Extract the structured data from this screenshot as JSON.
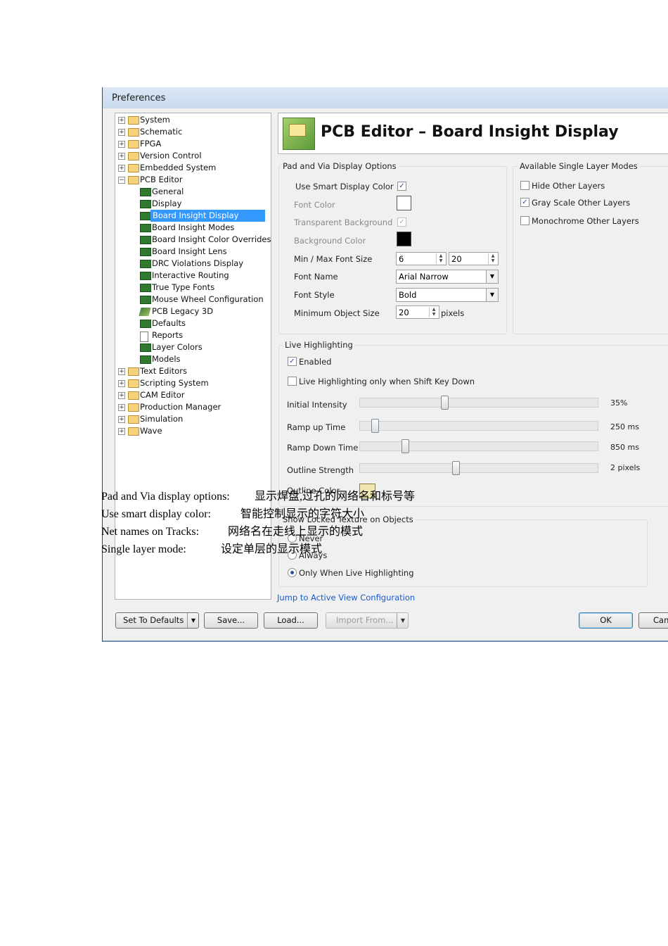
{
  "window": {
    "title": "Preferences"
  },
  "tree": {
    "items": [
      {
        "label": "System",
        "level": 0,
        "expander": "+",
        "icon": "folder-icon"
      },
      {
        "label": "Schematic",
        "level": 0,
        "expander": "+",
        "icon": "folder-icon"
      },
      {
        "label": "FPGA",
        "level": 0,
        "expander": "+",
        "icon": "folder-icon"
      },
      {
        "label": "Version Control",
        "level": 0,
        "expander": "+",
        "icon": "folder-icon"
      },
      {
        "label": "Embedded System",
        "level": 0,
        "expander": "+",
        "icon": "folder-icon"
      },
      {
        "label": "PCB Editor",
        "level": 0,
        "expander": "−",
        "icon": "folder-open-icon"
      },
      {
        "label": "General",
        "level": 1,
        "icon": "chip-icon"
      },
      {
        "label": "Display",
        "level": 1,
        "icon": "chip-icon"
      },
      {
        "label": "Board Insight Display",
        "level": 1,
        "icon": "chip-icon",
        "selected": true
      },
      {
        "label": "Board Insight Modes",
        "level": 1,
        "icon": "chip-icon"
      },
      {
        "label": "Board Insight Color Overrides",
        "level": 1,
        "icon": "chip-icon"
      },
      {
        "label": "Board Insight Lens",
        "level": 1,
        "icon": "chip-icon"
      },
      {
        "label": "DRC Violations Display",
        "level": 1,
        "icon": "chip-icon"
      },
      {
        "label": "Interactive Routing",
        "level": 1,
        "icon": "chip-icon"
      },
      {
        "label": "True Type Fonts",
        "level": 1,
        "icon": "chip-icon"
      },
      {
        "label": "Mouse Wheel Configuration",
        "level": 1,
        "icon": "chip-icon"
      },
      {
        "label": "PCB Legacy 3D",
        "level": 1,
        "icon": "legacy-3d-icon"
      },
      {
        "label": "Defaults",
        "level": 1,
        "icon": "chip-icon"
      },
      {
        "label": "Reports",
        "level": 1,
        "icon": "document-icon"
      },
      {
        "label": "Layer Colors",
        "level": 1,
        "icon": "chip-icon"
      },
      {
        "label": "Models",
        "level": 1,
        "icon": "chip-icon"
      },
      {
        "label": "Text Editors",
        "level": 0,
        "expander": "+",
        "icon": "folder-icon"
      },
      {
        "label": "Scripting System",
        "level": 0,
        "expander": "+",
        "icon": "folder-icon"
      },
      {
        "label": "CAM Editor",
        "level": 0,
        "expander": "+",
        "icon": "folder-icon"
      },
      {
        "label": "Production Manager",
        "level": 0,
        "expander": "+",
        "icon": "folder-icon"
      },
      {
        "label": "Simulation",
        "level": 0,
        "expander": "+",
        "icon": "folder-icon"
      },
      {
        "label": "Wave",
        "level": 0,
        "expander": "+",
        "icon": "folder-icon"
      }
    ]
  },
  "header": {
    "title": "PCB Editor – Board Insight Display",
    "icon": "pcb-board-icon"
  },
  "pad_via": {
    "group_title": "Pad and Via Display Options",
    "use_smart_label": "Use Smart Display Color",
    "use_smart_checked": true,
    "font_color_label": "Font Color",
    "font_color": "#ffffff",
    "transparent_bg_label": "Transparent Background",
    "transparent_bg_checked": true,
    "bg_color_label": "Background Color",
    "bg_color": "#000000",
    "font_size_label": "Min / Max Font Size",
    "min_font": "6",
    "max_font": "20",
    "font_name_label": "Font Name",
    "font_name": "Arial Narrow",
    "font_style_label": "Font Style",
    "font_style": "Bold",
    "min_obj_label": "Minimum Object Size",
    "min_obj": "20",
    "min_obj_unit": "pixels"
  },
  "layer_modes": {
    "group_title": "Available Single Layer Modes",
    "hide_other": "Hide Other Layers",
    "hide_other_checked": false,
    "gray_scale": "Gray Scale Other Layers",
    "gray_scale_checked": true,
    "monochrome": "Monochrome Other Layers",
    "monochrome_checked": false
  },
  "live": {
    "group_title": "Live Highlighting",
    "enabled_label": "Enabled",
    "enabled_checked": true,
    "shift_label": "Live Highlighting only when Shift Key Down",
    "shift_checked": false,
    "initial_intensity_label": "Initial Intensity",
    "initial_intensity_value": "35%",
    "initial_intensity_level": 0.35,
    "ramp_up_label": "Ramp up Time",
    "ramp_up_value": "250 ms",
    "ramp_up_level": 0.05,
    "ramp_down_label": "Ramp Down Time",
    "ramp_down_value": "850 ms",
    "ramp_down_level": 0.18,
    "outline_label": "Outline Strength",
    "outline_value": "2 pixels",
    "outline_level": 0.4,
    "outline_color_label": "Outline Color"
  },
  "locked": {
    "group_title": "Show Locked Texture on Objects",
    "never": "Never",
    "always": "Always",
    "only_live": "Only When Live Highlighting",
    "selected": "only_live"
  },
  "link": "Jump to Active View Configuration",
  "buttons": {
    "set_defaults": "Set To Defaults",
    "save": "Save...",
    "load": "Load...",
    "import_from": "Import From...",
    "ok": "OK",
    "cancel": "Can"
  },
  "annotations": [
    {
      "term": "Pad and Via display options:",
      "desc": "显示焊盘,过孔的网络名和标号等"
    },
    {
      "term": "Use smart display color:",
      "desc": "智能控制显示的字符大小"
    },
    {
      "term": "Net names on Tracks:",
      "desc": "网络名在走线上显示的模式"
    },
    {
      "term": "Single layer mode:",
      "desc": "设定单层的显示模式"
    }
  ]
}
